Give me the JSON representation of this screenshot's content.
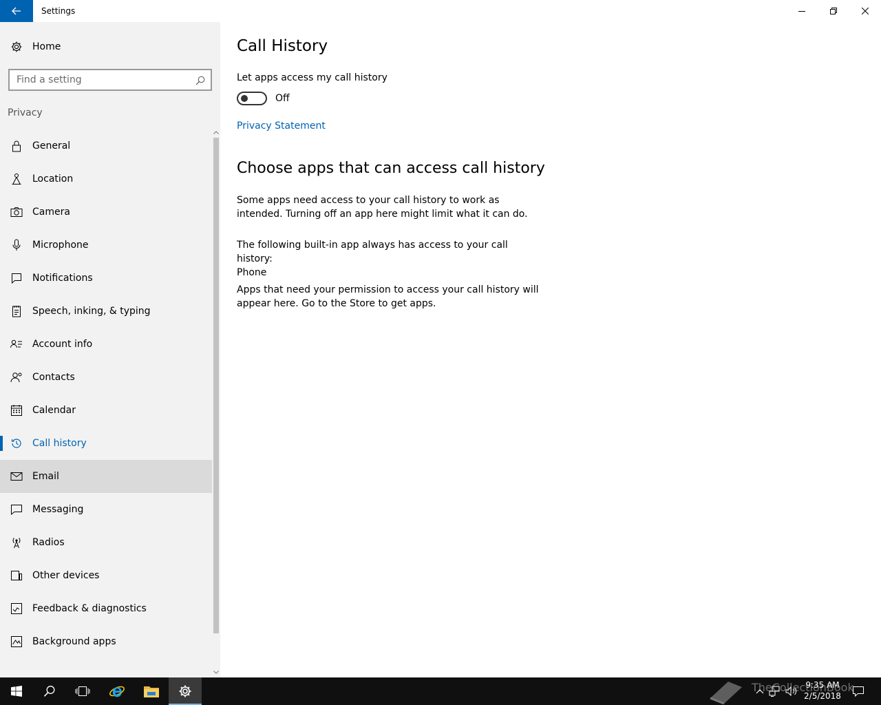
{
  "window": {
    "title": "Settings"
  },
  "sidebar": {
    "home_label": "Home",
    "search_placeholder": "Find a setting",
    "section_label": "Privacy",
    "items": [
      {
        "label": "General",
        "icon": "lock-icon"
      },
      {
        "label": "Location",
        "icon": "location-icon"
      },
      {
        "label": "Camera",
        "icon": "camera-icon"
      },
      {
        "label": "Microphone",
        "icon": "microphone-icon"
      },
      {
        "label": "Notifications",
        "icon": "notifications-icon"
      },
      {
        "label": "Speech, inking, & typing",
        "icon": "speech-icon"
      },
      {
        "label": "Account info",
        "icon": "account-info-icon"
      },
      {
        "label": "Contacts",
        "icon": "contacts-icon"
      },
      {
        "label": "Calendar",
        "icon": "calendar-icon"
      },
      {
        "label": "Call history",
        "icon": "history-icon",
        "selected": true
      },
      {
        "label": "Email",
        "icon": "email-icon",
        "hovered": true
      },
      {
        "label": "Messaging",
        "icon": "messaging-icon"
      },
      {
        "label": "Radios",
        "icon": "radio-icon"
      },
      {
        "label": "Other devices",
        "icon": "devices-icon"
      },
      {
        "label": "Feedback & diagnostics",
        "icon": "feedback-icon"
      },
      {
        "label": "Background apps",
        "icon": "background-apps-icon"
      }
    ]
  },
  "main": {
    "title": "Call History",
    "toggle_label": "Let apps access my call history",
    "toggle_state": "Off",
    "privacy_link": "Privacy Statement",
    "section_heading": "Choose apps that can access call history",
    "para1": "Some apps need access to your call history to work as intended. Turning off an app here might limit what it can do.",
    "para2_line1": "The following built-in app always has access to your call history:",
    "para2_line2": "Phone",
    "para3": "Apps that need your permission to access your call history will appear here. Go to the Store to get apps."
  },
  "taskbar": {
    "time": "9:35 AM",
    "date": "2/5/2018",
    "watermark": "TheCollectionBook"
  },
  "colors": {
    "accent": "#0063b1",
    "sidebar_bg": "#f2f2f2",
    "hover_bg": "#dadada",
    "taskbar_bg": "#101010"
  }
}
